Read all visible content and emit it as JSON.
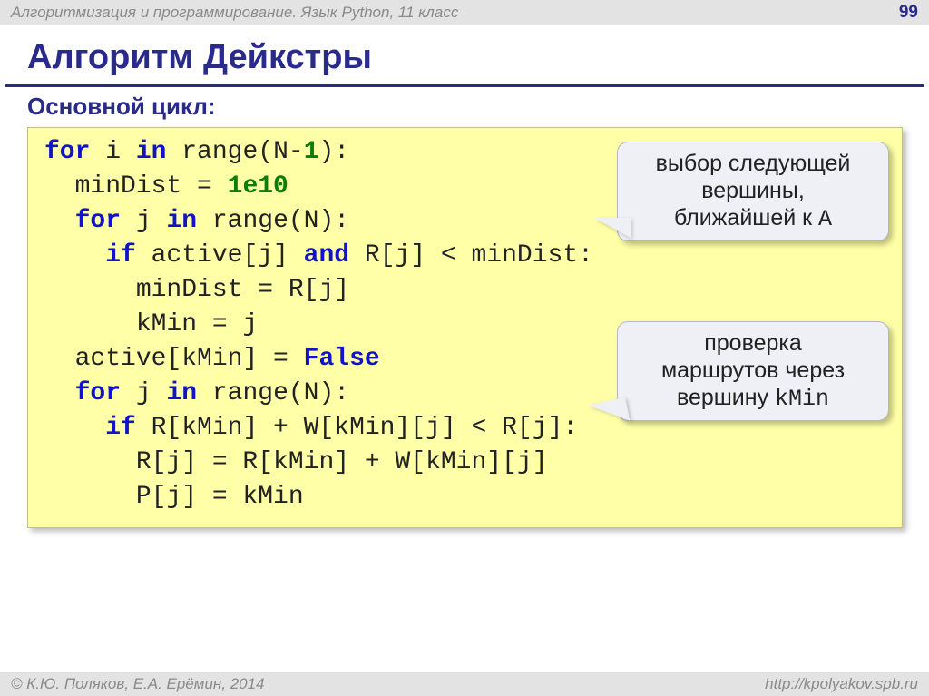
{
  "header": {
    "course": "Алгоритмизация и программирование. Язык Python, 11 класс",
    "page": "99"
  },
  "title": "Алгоритм Дейкстры",
  "subtitle": "Основной цикл:",
  "code": {
    "l1a": "for",
    "l1b": " i ",
    "l1c": "in",
    "l1d": " range(N-",
    "l1e": "1",
    "l1f": "):",
    "l2a": "  minDist = ",
    "l2b": "1e10",
    "l3a": "  ",
    "l3b": "for",
    "l3c": " j ",
    "l3d": "in",
    "l3e": " range(N):",
    "l4a": "    ",
    "l4b": "if",
    "l4c": " active[j] ",
    "l4d": "and",
    "l4e": " R[j] < minDist:",
    "l5": "      minDist = R[j]",
    "l6": "      kMin = j",
    "l7a": "  active[kMin] = ",
    "l7b": "False",
    "l8a": "  ",
    "l8b": "for",
    "l8c": " j ",
    "l8d": "in",
    "l8e": " range(N):",
    "l9a": "    ",
    "l9b": "if",
    "l9c": " R[kMin] + W[kMin][j] < R[j]:",
    "l10": "      R[j] = R[kMin] + W[kMin][j]",
    "l11": "      P[j] = kMin"
  },
  "callout1": {
    "line1": "выбор следующей",
    "line2": "вершины,",
    "line3a": "ближайшей к ",
    "line3b": "A"
  },
  "callout2": {
    "line1": "проверка",
    "line2": "маршрутов через",
    "line3a": "вершину ",
    "line3b": "kMin"
  },
  "footer": {
    "left": "© К.Ю. Поляков, Е.А. Ерёмин, 2014",
    "right": "http://kpolyakov.spb.ru"
  }
}
